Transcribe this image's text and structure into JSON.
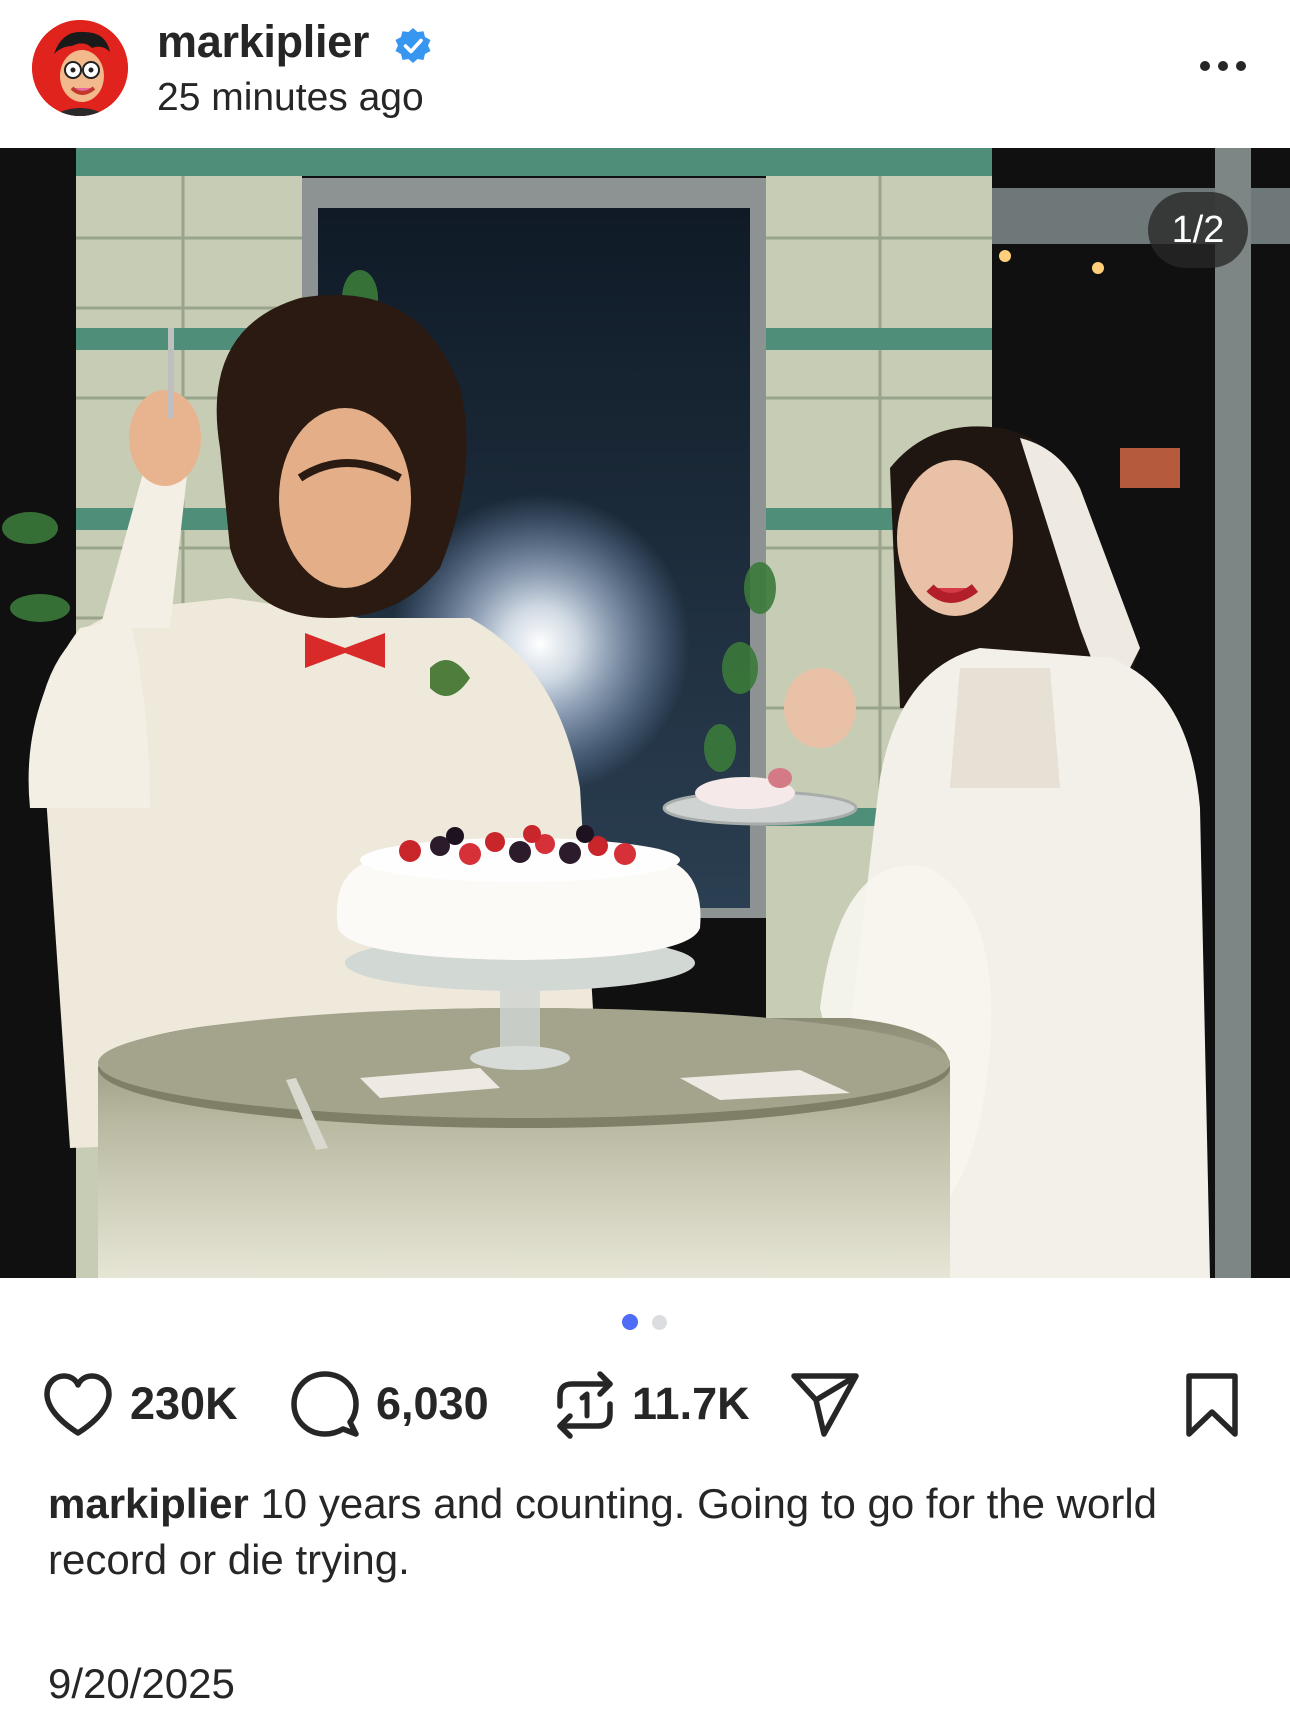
{
  "post": {
    "username": "markiplier",
    "verified": true,
    "time_ago": "25 minutes ago",
    "more_icon": "more-horizontal-icon",
    "image_counter": "1/2",
    "carousel": {
      "total": 2,
      "active": 1
    },
    "likes": "230K",
    "comments": "6,030",
    "reposts": "11.7K",
    "caption_user": "markiplier",
    "caption_text": "10 years and counting. Going to go for the world record or die trying.",
    "date": "9/20/2025"
  },
  "colors": {
    "verified_badge": "#3797f0",
    "dot_active": "#4f6cf7",
    "dot_inactive": "#dbdde0",
    "avatar_bg": "#e0231c",
    "text": "#262626"
  }
}
